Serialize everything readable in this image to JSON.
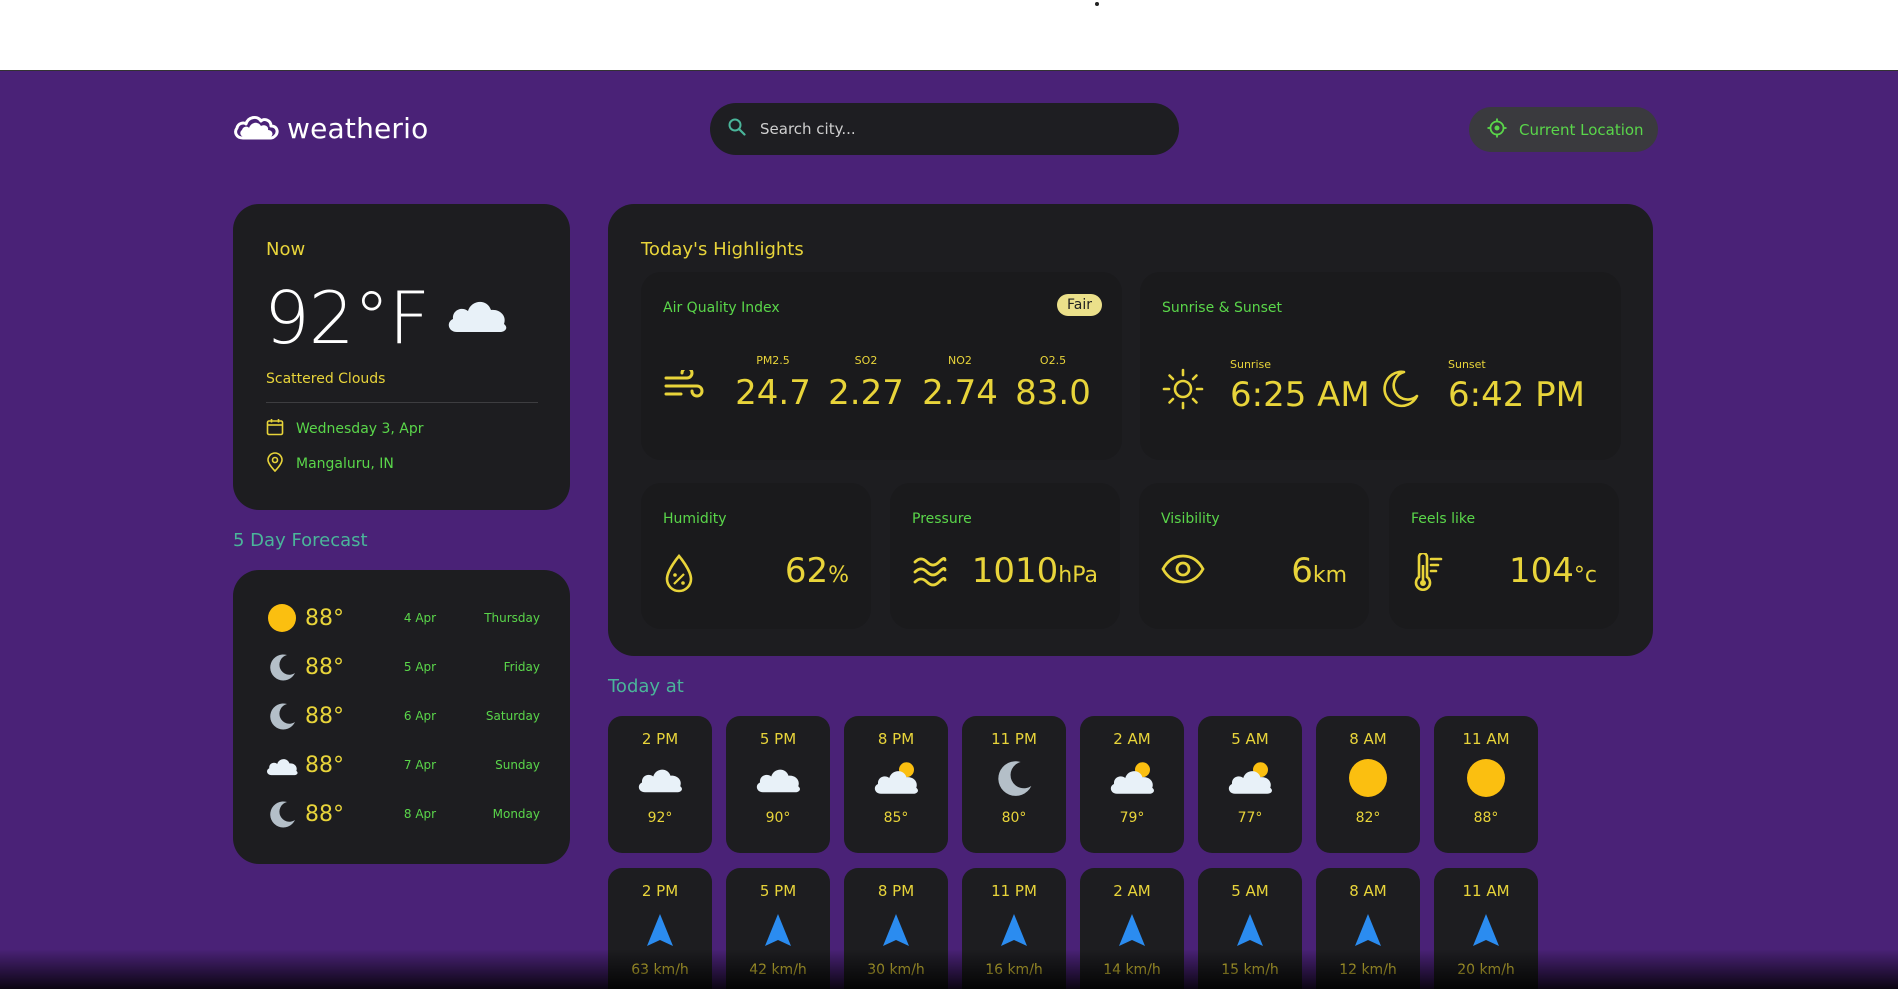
{
  "app": {
    "name": "weatherio"
  },
  "search": {
    "placeholder": "Search city..."
  },
  "location_button": {
    "label": "Current Location"
  },
  "now": {
    "label": "Now",
    "temp": "92°F",
    "description": "Scattered Clouds",
    "date": "Wednesday 3, Apr",
    "location": "Mangaluru, IN"
  },
  "forecast": {
    "title": "5 Day Forecast",
    "items": [
      {
        "icon": "sun-icon",
        "temp": "88°",
        "date": "4 Apr",
        "day": "Thursday"
      },
      {
        "icon": "moon-icon",
        "temp": "88°",
        "date": "5 Apr",
        "day": "Friday"
      },
      {
        "icon": "moon-icon",
        "temp": "88°",
        "date": "6 Apr",
        "day": "Saturday"
      },
      {
        "icon": "cloud-icon",
        "temp": "88°",
        "date": "7 Apr",
        "day": "Sunday"
      },
      {
        "icon": "moon-icon",
        "temp": "88°",
        "date": "8 Apr",
        "day": "Monday"
      }
    ]
  },
  "highlights": {
    "title": "Today's Highlights",
    "aqi": {
      "title": "Air Quality Index",
      "badge": "Fair",
      "items": [
        {
          "label": "PM2.5",
          "value": "24.7"
        },
        {
          "label": "SO2",
          "value": "2.27"
        },
        {
          "label": "NO2",
          "value": "2.74"
        },
        {
          "label": "O2.5",
          "value": "83.0"
        }
      ]
    },
    "sun": {
      "title": "Sunrise & Sunset",
      "sunrise_label": "Sunrise",
      "sunrise": "6:25 AM",
      "sunset_label": "Sunset",
      "sunset": "6:42 PM"
    },
    "humidity": {
      "title": "Humidity",
      "value": "62",
      "unit": "%"
    },
    "pressure": {
      "title": "Pressure",
      "value": "1010",
      "unit": "hPa"
    },
    "visibility": {
      "title": "Visibility",
      "value": "6",
      "unit": "km"
    },
    "feels_like": {
      "title": "Feels like",
      "value": "104",
      "unit": "°c"
    }
  },
  "today": {
    "title": "Today at",
    "hours": [
      {
        "time": "2 PM",
        "icon": "cloud-icon",
        "temp": "92°"
      },
      {
        "time": "5 PM",
        "icon": "cloud-icon",
        "temp": "90°"
      },
      {
        "time": "8 PM",
        "icon": "cloud-sun-icon",
        "temp": "85°"
      },
      {
        "time": "11 PM",
        "icon": "moon-icon",
        "temp": "80°"
      },
      {
        "time": "2 AM",
        "icon": "cloud-sun-icon",
        "temp": "79°"
      },
      {
        "time": "5 AM",
        "icon": "cloud-sun-icon",
        "temp": "77°"
      },
      {
        "time": "8 AM",
        "icon": "sun-icon",
        "temp": "82°"
      },
      {
        "time": "11 AM",
        "icon": "sun-icon",
        "temp": "88°"
      }
    ],
    "wind": [
      {
        "time": "2 PM",
        "speed": "63 km/h"
      },
      {
        "time": "5 PM",
        "speed": "42 km/h"
      },
      {
        "time": "8 PM",
        "speed": "30 km/h"
      },
      {
        "time": "11 PM",
        "speed": "16 km/h"
      },
      {
        "time": "2 AM",
        "speed": "14 km/h"
      },
      {
        "time": "5 AM",
        "speed": "15 km/h"
      },
      {
        "time": "8 AM",
        "speed": "12 km/h"
      },
      {
        "time": "11 AM",
        "speed": "20 km/h"
      }
    ]
  },
  "colors": {
    "background": "#4a2277",
    "card": "#1d1d20",
    "accent_yellow": "#e8d43a",
    "accent_green": "#5ad64a",
    "wind_arrow": "#2b8cf0"
  }
}
